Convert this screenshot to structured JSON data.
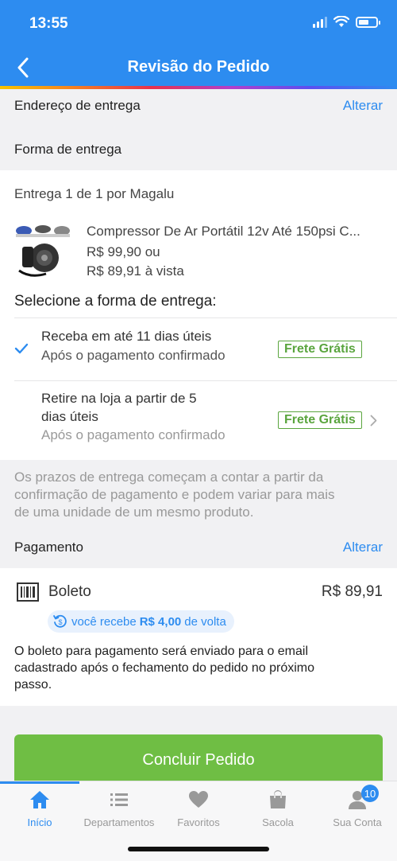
{
  "status_bar": {
    "time": "13:55"
  },
  "header": {
    "title": "Revisão do Pedido"
  },
  "address": {
    "label": "Endereço de entrega",
    "action": "Alterar"
  },
  "shipping_method": {
    "label": "Forma de entrega"
  },
  "delivery": {
    "shipment_prefix": "Entrega 1 de 1",
    "shipment_seller": " por Magalu",
    "product": {
      "name": "Compressor De Ar Portátil 12v Até 150psi C...",
      "price_installment": "R$ 99,90 ou",
      "price_cash": "R$ 89,91 à vista"
    },
    "select_title": "Selecione a forma de entrega:",
    "options": [
      {
        "title": "Receba em até 11 dias úteis",
        "subtitle": "Após o pagamento confirmado",
        "badge": "Frete Grátis",
        "selected": true
      },
      {
        "title_line1": "Retire na loja a partir de 5",
        "title_line2": "dias úteis",
        "subtitle": "Após o pagamento confirmado",
        "badge": "Frete Grátis",
        "selected": false
      }
    ]
  },
  "notice": {
    "line1": "Os prazos de entrega começam a contar a partir da",
    "line2": "confirmação de pagamento e podem variar para mais",
    "line3": "de uma unidade de um mesmo produto."
  },
  "payment": {
    "label": "Pagamento",
    "action": "Alterar",
    "method": "Boleto",
    "amount": "R$ 89,91",
    "cashback_prefix": "você recebe",
    "cashback_value": "R$ 4,00",
    "cashback_suffix": "de volta",
    "info_line1": "O boleto para pagamento será enviado para o email",
    "info_line2": "cadastrado após o fechamento do pedido no próximo",
    "info_line3": "passo."
  },
  "cta": {
    "label": "Concluir Pedido"
  },
  "tabbar": {
    "items": [
      {
        "label": "Início",
        "icon": "home-icon",
        "active": true
      },
      {
        "label": "Departamentos",
        "icon": "list-icon"
      },
      {
        "label": "Favoritos",
        "icon": "heart-icon"
      },
      {
        "label": "Sacola",
        "icon": "bag-icon"
      },
      {
        "label": "Sua Conta",
        "icon": "user-icon",
        "badge": "10"
      }
    ]
  },
  "colors": {
    "primary": "#2d8cf0",
    "success": "#6fbe44",
    "badge_green": "#5aa53e"
  }
}
